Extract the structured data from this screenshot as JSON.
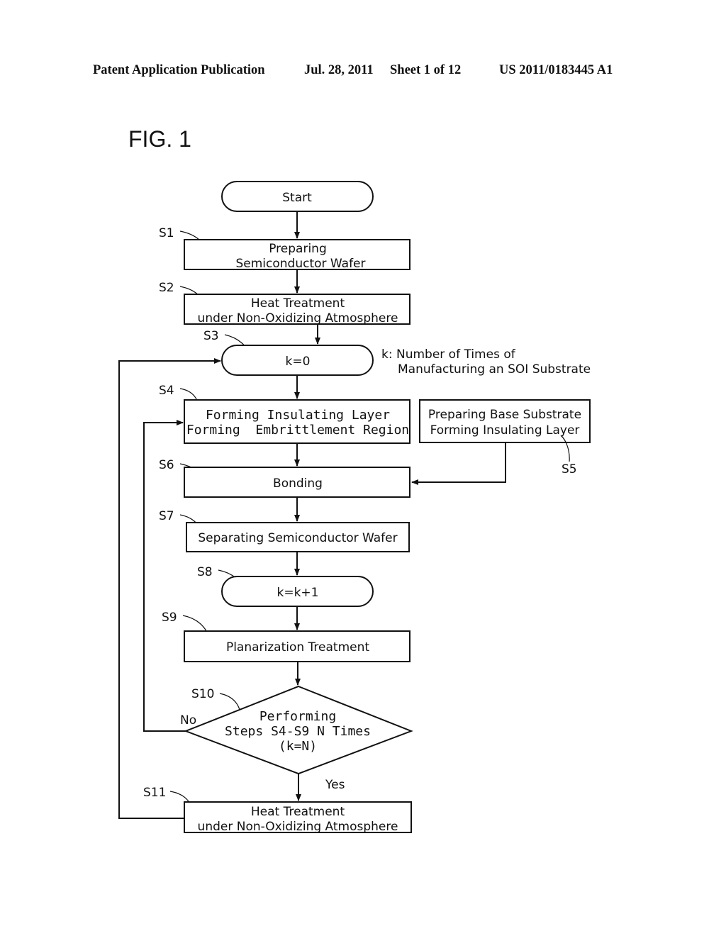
{
  "header": {
    "publication": "Patent Application Publication",
    "date": "Jul. 28, 2011",
    "sheet": "Sheet 1 of 12",
    "number": "US 2011/0183445 A1"
  },
  "figure": {
    "title": "FIG. 1"
  },
  "flowchart": {
    "start": "Start",
    "s1": {
      "label": "S1",
      "lines": [
        "Preparing",
        "Semiconductor Wafer"
      ]
    },
    "s2": {
      "label": "S2",
      "lines": [
        "Heat Treatment",
        "under Non-Oxidizing Atmosphere"
      ]
    },
    "s3": {
      "label": "S3",
      "text": "k=0"
    },
    "note": {
      "lines": [
        "k: Number of Times of",
        "Manufacturing an SOI Substrate"
      ]
    },
    "s4": {
      "label": "S4",
      "lines": [
        "Forming Insulating Layer",
        "Forming  Embrittlement Region"
      ]
    },
    "s5": {
      "label": "S5",
      "lines": [
        "Preparing Base Substrate",
        "Forming Insulating Layer"
      ]
    },
    "s6": {
      "label": "S6",
      "text": "Bonding"
    },
    "s7": {
      "label": "S7",
      "text": "Separating Semiconductor Wafer"
    },
    "s8": {
      "label": "S8",
      "text": "k=k+1"
    },
    "s9": {
      "label": "S9",
      "text": "Planarization Treatment"
    },
    "s10": {
      "label": "S10",
      "lines": [
        "Performing",
        "Steps S4-S9 N Times",
        "(k=N)"
      ],
      "no": "No",
      "yes": "Yes"
    },
    "s11": {
      "label": "S11",
      "lines": [
        "Heat Treatment",
        "under Non-Oxidizing Atmosphere"
      ]
    }
  }
}
